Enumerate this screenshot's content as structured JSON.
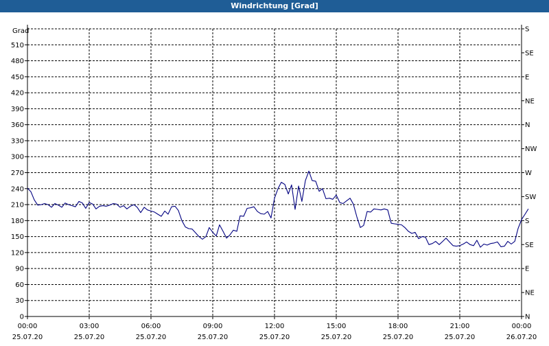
{
  "header": {
    "title": "Windrichtung [Grad]"
  },
  "chart_data": {
    "type": "line",
    "title": "Windrichtung [Grad]",
    "ylabel": "Grad",
    "ylim": [
      0,
      540
    ],
    "yticks": [
      0,
      30,
      60,
      90,
      120,
      150,
      180,
      210,
      240,
      270,
      300,
      330,
      360,
      390,
      420,
      450,
      480,
      510
    ],
    "right_axis_labels": [
      {
        "value": 0,
        "label": "N"
      },
      {
        "value": 45,
        "label": "NE"
      },
      {
        "value": 90,
        "label": "E"
      },
      {
        "value": 135,
        "label": "SE"
      },
      {
        "value": 180,
        "label": "S"
      },
      {
        "value": 225,
        "label": "SW"
      },
      {
        "value": 270,
        "label": "W"
      },
      {
        "value": 315,
        "label": "NW"
      },
      {
        "value": 360,
        "label": "N"
      },
      {
        "value": 405,
        "label": "NE"
      },
      {
        "value": 450,
        "label": "E"
      },
      {
        "value": 495,
        "label": "SE"
      },
      {
        "value": 540,
        "label": "S"
      }
    ],
    "xlim": [
      0,
      24
    ],
    "xticks": [
      {
        "value": 0,
        "time": "00:00",
        "date": "25.07.20"
      },
      {
        "value": 3,
        "time": "03:00",
        "date": "25.07.20"
      },
      {
        "value": 6,
        "time": "06:00",
        "date": "25.07.20"
      },
      {
        "value": 9,
        "time": "09:00",
        "date": "25.07.20"
      },
      {
        "value": 12,
        "time": "12:00",
        "date": "25.07.20"
      },
      {
        "value": 15,
        "time": "15:00",
        "date": "25.07.20"
      },
      {
        "value": 18,
        "time": "18:00",
        "date": "25.07.20"
      },
      {
        "value": 21,
        "time": "21:00",
        "date": "25.07.20"
      },
      {
        "value": 24,
        "time": "00:00",
        "date": "26.07.20"
      }
    ],
    "grid": true,
    "series": [
      {
        "color": "#000080",
        "points": [
          [
            0.0,
            241
          ],
          [
            0.17,
            234
          ],
          [
            0.33,
            219
          ],
          [
            0.5,
            209
          ],
          [
            0.67,
            210
          ],
          [
            0.83,
            212
          ],
          [
            1.0,
            210
          ],
          [
            1.17,
            205
          ],
          [
            1.33,
            212
          ],
          [
            1.5,
            209
          ],
          [
            1.67,
            205
          ],
          [
            1.83,
            213
          ],
          [
            2.0,
            210
          ],
          [
            2.17,
            208
          ],
          [
            2.33,
            206
          ],
          [
            2.5,
            216
          ],
          [
            2.67,
            213
          ],
          [
            2.83,
            203
          ],
          [
            3.0,
            214
          ],
          [
            3.17,
            211
          ],
          [
            3.33,
            202
          ],
          [
            3.5,
            207
          ],
          [
            3.67,
            208
          ],
          [
            3.83,
            207
          ],
          [
            4.0,
            209
          ],
          [
            4.17,
            212
          ],
          [
            4.33,
            211
          ],
          [
            4.5,
            205
          ],
          [
            4.67,
            208
          ],
          [
            4.83,
            202
          ],
          [
            5.0,
            207
          ],
          [
            5.17,
            210
          ],
          [
            5.33,
            205
          ],
          [
            5.5,
            195
          ],
          [
            5.67,
            205
          ],
          [
            5.83,
            200
          ],
          [
            6.0,
            198
          ],
          [
            6.17,
            196
          ],
          [
            6.33,
            192
          ],
          [
            6.5,
            188
          ],
          [
            6.67,
            198
          ],
          [
            6.83,
            192
          ],
          [
            7.0,
            206
          ],
          [
            7.17,
            207
          ],
          [
            7.33,
            199
          ],
          [
            7.5,
            180
          ],
          [
            7.67,
            168
          ],
          [
            7.83,
            165
          ],
          [
            8.0,
            164
          ],
          [
            8.17,
            157
          ],
          [
            8.33,
            150
          ],
          [
            8.5,
            145
          ],
          [
            8.67,
            150
          ],
          [
            8.83,
            167
          ],
          [
            9.0,
            158
          ],
          [
            9.17,
            151
          ],
          [
            9.33,
            172
          ],
          [
            9.5,
            160
          ],
          [
            9.67,
            147
          ],
          [
            9.83,
            153
          ],
          [
            10.0,
            162
          ],
          [
            10.17,
            160
          ],
          [
            10.33,
            189
          ],
          [
            10.5,
            188
          ],
          [
            10.67,
            203
          ],
          [
            10.83,
            204
          ],
          [
            11.0,
            206
          ],
          [
            11.17,
            197
          ],
          [
            11.33,
            193
          ],
          [
            11.5,
            192
          ],
          [
            11.67,
            197
          ],
          [
            11.83,
            185
          ],
          [
            12.0,
            222
          ],
          [
            12.17,
            240
          ],
          [
            12.33,
            252
          ],
          [
            12.5,
            248
          ],
          [
            12.67,
            230
          ],
          [
            12.83,
            247
          ],
          [
            13.0,
            201
          ],
          [
            13.17,
            245
          ],
          [
            13.33,
            216
          ],
          [
            13.5,
            255
          ],
          [
            13.67,
            273
          ],
          [
            13.83,
            255
          ],
          [
            14.0,
            254
          ],
          [
            14.17,
            235
          ],
          [
            14.33,
            240
          ],
          [
            14.5,
            221
          ],
          [
            14.67,
            222
          ],
          [
            14.83,
            220
          ],
          [
            15.0,
            228
          ],
          [
            15.17,
            214
          ],
          [
            15.33,
            212
          ],
          [
            15.5,
            217
          ],
          [
            15.67,
            222
          ],
          [
            15.83,
            211
          ],
          [
            16.0,
            187
          ],
          [
            16.17,
            167
          ],
          [
            16.33,
            171
          ],
          [
            16.5,
            197
          ],
          [
            16.67,
            196
          ],
          [
            16.83,
            202
          ],
          [
            17.0,
            201
          ],
          [
            17.17,
            200
          ],
          [
            17.33,
            202
          ],
          [
            17.5,
            200
          ],
          [
            17.67,
            175
          ],
          [
            17.83,
            174
          ],
          [
            18.0,
            173
          ],
          [
            18.17,
            172
          ],
          [
            18.33,
            167
          ],
          [
            18.5,
            160
          ],
          [
            18.67,
            156
          ],
          [
            18.83,
            158
          ],
          [
            19.0,
            146
          ],
          [
            19.17,
            150
          ],
          [
            19.33,
            149
          ],
          [
            19.5,
            135
          ],
          [
            19.67,
            137
          ],
          [
            19.83,
            141
          ],
          [
            20.0,
            135
          ],
          [
            20.17,
            141
          ],
          [
            20.33,
            147
          ],
          [
            20.5,
            140
          ],
          [
            20.67,
            133
          ],
          [
            20.83,
            132
          ],
          [
            21.0,
            133
          ],
          [
            21.17,
            136
          ],
          [
            21.33,
            140
          ],
          [
            21.5,
            135
          ],
          [
            21.67,
            133
          ],
          [
            21.83,
            143
          ],
          [
            22.0,
            130
          ],
          [
            22.17,
            136
          ],
          [
            22.33,
            134
          ],
          [
            22.5,
            137
          ],
          [
            22.67,
            138
          ],
          [
            22.83,
            140
          ],
          [
            23.0,
            131
          ],
          [
            23.17,
            132
          ],
          [
            23.33,
            141
          ],
          [
            23.5,
            136
          ],
          [
            23.67,
            141
          ],
          [
            23.83,
            165
          ],
          [
            24.0,
            182
          ],
          [
            24.17,
            192
          ],
          [
            24.33,
            202
          ]
        ]
      }
    ]
  }
}
